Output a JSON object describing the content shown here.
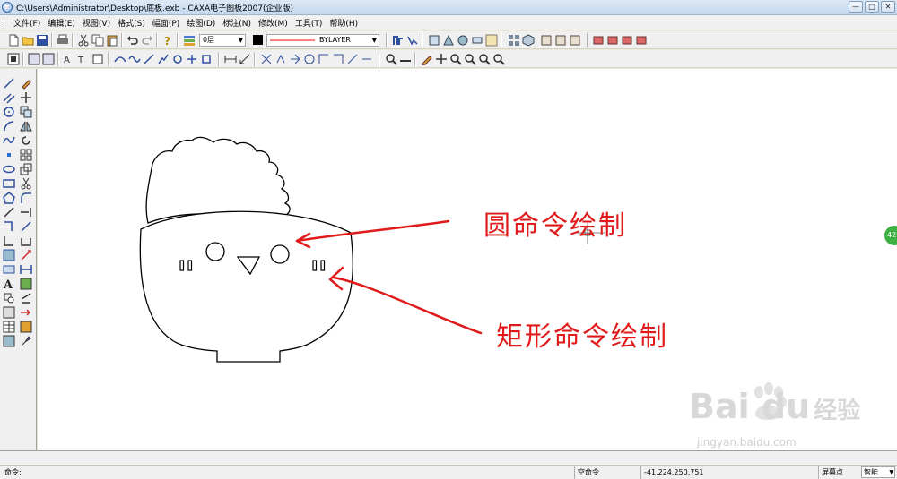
{
  "window": {
    "title": "C:\\Users\\Administrator\\Desktop\\底板.exb - CAXA电子图板2007(企业版)",
    "buttons": [
      "—",
      "□",
      "✕"
    ]
  },
  "menu": [
    "文件(F)",
    "编辑(E)",
    "视图(V)",
    "格式(S)",
    "幅面(P)",
    "绘图(D)",
    "标注(N)",
    "修改(M)",
    "工具(T)",
    "帮助(H)"
  ],
  "toolbar": {
    "layer_value": "0层",
    "linetype_value": "BYLAYER",
    "line_color": "#ff0000"
  },
  "canvas": {
    "annotation_circle": "圆命令绘制",
    "annotation_rect": "矩形命令绘制",
    "annotation_color": "#e01a1a",
    "badge": "42",
    "watermark_logo": "Bai du",
    "watermark_cn": "经验",
    "watermark_url": "jingyan.baidu.com"
  },
  "statusbar": {
    "prompt": "命令:",
    "command_state": "空命令",
    "coordinates": "-41.224,250.751",
    "snap_label": "屏幕点",
    "snap_mode": "智能"
  }
}
